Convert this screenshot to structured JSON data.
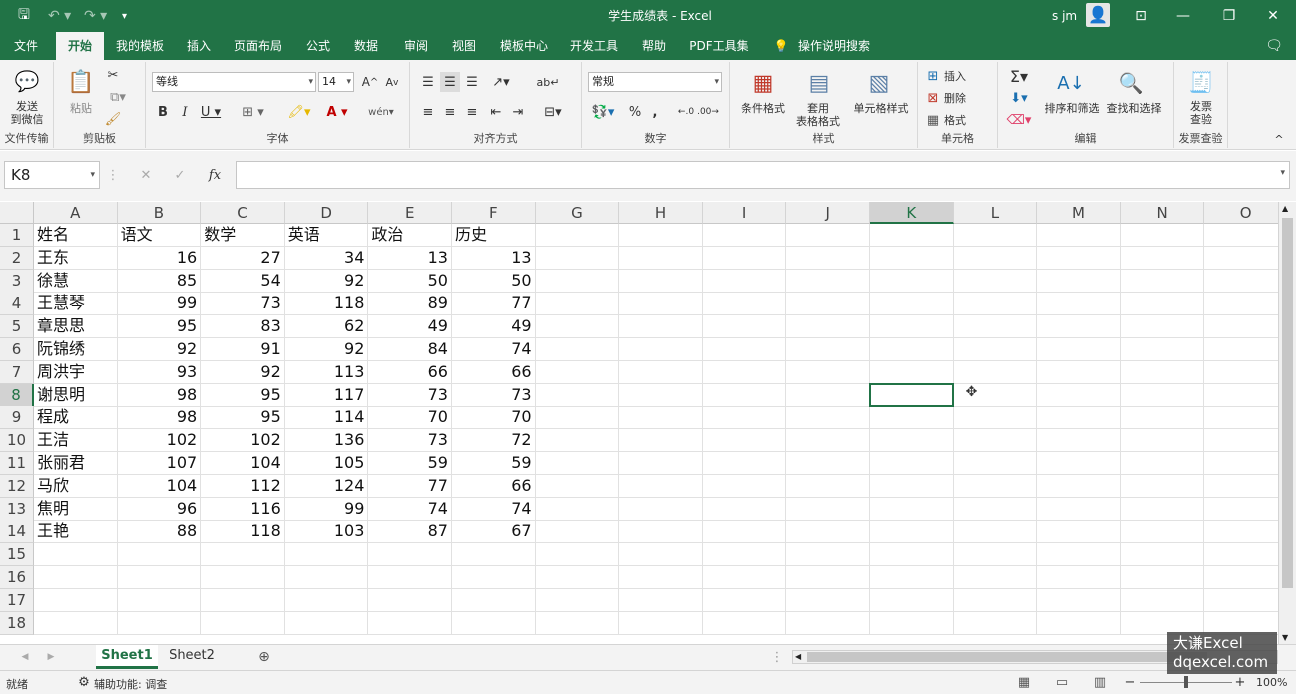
{
  "window": {
    "title": "学生成绩表 - Excel",
    "user": "s jm"
  },
  "menu_tabs": [
    {
      "label": "文件"
    },
    {
      "label": "开始"
    },
    {
      "label": "我的模板"
    },
    {
      "label": "插入"
    },
    {
      "label": "页面布局"
    },
    {
      "label": "公式"
    },
    {
      "label": "数据"
    },
    {
      "label": "审阅"
    },
    {
      "label": "视图"
    },
    {
      "label": "模板中心"
    },
    {
      "label": "开发工具"
    },
    {
      "label": "帮助"
    },
    {
      "label": "PDF工具集"
    },
    {
      "label": "操作说明搜索"
    }
  ],
  "ribbon": {
    "send_wechat": "发送\n到微信",
    "paste": "粘贴",
    "font_name": "等线",
    "font_size": "14",
    "number_format": "常规",
    "cond_format": "条件格式",
    "table_format": "套用\n表格格式",
    "cell_style": "单元格样式",
    "insert": "插入",
    "delete": "删除",
    "format": "格式",
    "sort_filter": "排序和筛选",
    "find_select": "查找和选择",
    "invoice_check": "发票\n查验",
    "groups": {
      "file_transfer": "文件传输",
      "clipboard": "剪贴板",
      "font": "字体",
      "alignment": "对齐方式",
      "number": "数字",
      "styles": "样式",
      "cells": "单元格",
      "editing": "编辑",
      "invoice": "发票查验"
    }
  },
  "formula_bar": {
    "name_box": "K8",
    "formula": ""
  },
  "columns": [
    "A",
    "B",
    "C",
    "D",
    "E",
    "F",
    "G",
    "H",
    "I",
    "J",
    "K",
    "L",
    "M",
    "N",
    "O"
  ],
  "selected_column": "K",
  "selected_row": 8,
  "rows": [
    "1",
    "2",
    "3",
    "4",
    "5",
    "6",
    "7",
    "8",
    "9",
    "10",
    "11",
    "12",
    "13",
    "14",
    "15",
    "16",
    "17",
    "18"
  ],
  "table": {
    "headers": [
      "姓名",
      "语文",
      "数学",
      "英语",
      "政治",
      "历史"
    ],
    "data": [
      [
        "王东",
        "16",
        "27",
        "34",
        "13",
        "13"
      ],
      [
        "徐慧",
        "85",
        "54",
        "92",
        "50",
        "50"
      ],
      [
        "王慧琴",
        "99",
        "73",
        "118",
        "89",
        "77"
      ],
      [
        "章思思",
        "95",
        "83",
        "62",
        "49",
        "49"
      ],
      [
        "阮锦绣",
        "92",
        "91",
        "92",
        "84",
        "74"
      ],
      [
        "周洪宇",
        "93",
        "92",
        "113",
        "66",
        "66"
      ],
      [
        "谢思明",
        "98",
        "95",
        "117",
        "73",
        "73"
      ],
      [
        "程成",
        "98",
        "95",
        "114",
        "70",
        "70"
      ],
      [
        "王洁",
        "102",
        "102",
        "136",
        "73",
        "72"
      ],
      [
        "张丽君",
        "107",
        "104",
        "105",
        "59",
        "59"
      ],
      [
        "马欣",
        "104",
        "112",
        "124",
        "77",
        "66"
      ],
      [
        "焦明",
        "96",
        "116",
        "99",
        "74",
        "74"
      ],
      [
        "王艳",
        "88",
        "118",
        "103",
        "87",
        "67"
      ]
    ]
  },
  "sheets": [
    {
      "label": "Sheet1"
    },
    {
      "label": "Sheet2"
    }
  ],
  "status": {
    "ready": "就绪",
    "accessibility": "辅助功能: 调查",
    "zoom": "100%"
  },
  "watermark": {
    "line1": "大谦Excel",
    "line2": "dqexcel.com"
  }
}
